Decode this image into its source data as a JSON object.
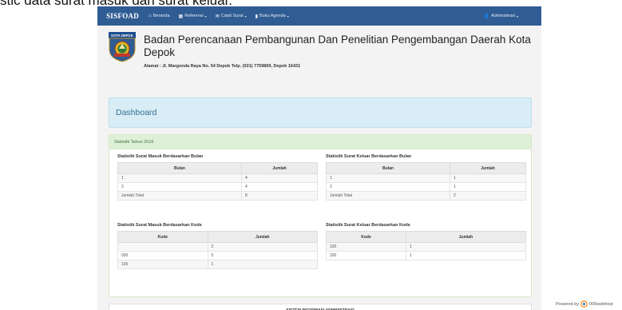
{
  "caption": "stic data surat masuk dan surat keluar.",
  "navbar": {
    "brand": "SISFOAD",
    "items": [
      {
        "label": "Beranda",
        "icon": "home-icon",
        "glyph": "⌂",
        "caret": ""
      },
      {
        "label": "Referensi",
        "icon": "grid-icon",
        "glyph": "▦",
        "caret": "▾"
      },
      {
        "label": "Catat Surat",
        "icon": "mail-icon",
        "glyph": "✉",
        "caret": "▾"
      },
      {
        "label": "Buku Agenda",
        "icon": "book-icon",
        "glyph": "▮",
        "caret": "▾"
      }
    ],
    "user": {
      "label": "Administrasi",
      "icon": "user-icon",
      "glyph": "👤",
      "caret": "▾"
    }
  },
  "header": {
    "logo_text": "KOTA DEPOK",
    "title": "Badan Perencanaan Pembangunan Dan Penelitian Pengembangan Daerah Kota Depok",
    "address": "Alamat : Jl. Margonda Raya No. 54 Depok Telp. (021) 7759869, Depok 16431"
  },
  "dashboard": {
    "title": "Dashboard"
  },
  "stats": {
    "heading": "Statistik Tahun 2016",
    "masuk_bulan": {
      "title": "Statistik Surat Masuk Berdasarkan Bulan",
      "headers": [
        "Bulan",
        "Jumlah"
      ],
      "rows": [
        [
          "1",
          "4"
        ],
        [
          "2",
          "4"
        ],
        [
          "Jumlah Total",
          "8"
        ]
      ]
    },
    "keluar_bulan": {
      "title": "Statistik Surat Keluar Berdasarkan Bulan",
      "headers": [
        "Bulan",
        "Jumlah"
      ],
      "rows": [
        [
          "1",
          "1"
        ],
        [
          "2",
          "1"
        ],
        [
          "Jumlah Total",
          "2"
        ]
      ]
    },
    "masuk_kode": {
      "title": "Statistik Surat Masuk Berdasarkan Kode",
      "headers": [
        "Kode",
        "Jumlah"
      ],
      "rows": [
        [
          "",
          "2"
        ],
        [
          "000",
          "5"
        ],
        [
          "100",
          "1"
        ]
      ]
    },
    "keluar_kode": {
      "title": "Statistik Surat Keluar Berdasarkan Kode",
      "headers": [
        "Kode",
        "Jumlah"
      ],
      "rows": [
        [
          "100",
          "1"
        ],
        [
          "200",
          "1"
        ]
      ]
    }
  },
  "footer": {
    "text": "SISTEM INFORMASI ADMINISTRASI"
  },
  "powered": {
    "prefix": "Powered by",
    "brand": "000webhost"
  },
  "colors": {
    "navbar": "#2f5c93",
    "info": "#d9edf7",
    "success": "#dff0d8"
  }
}
